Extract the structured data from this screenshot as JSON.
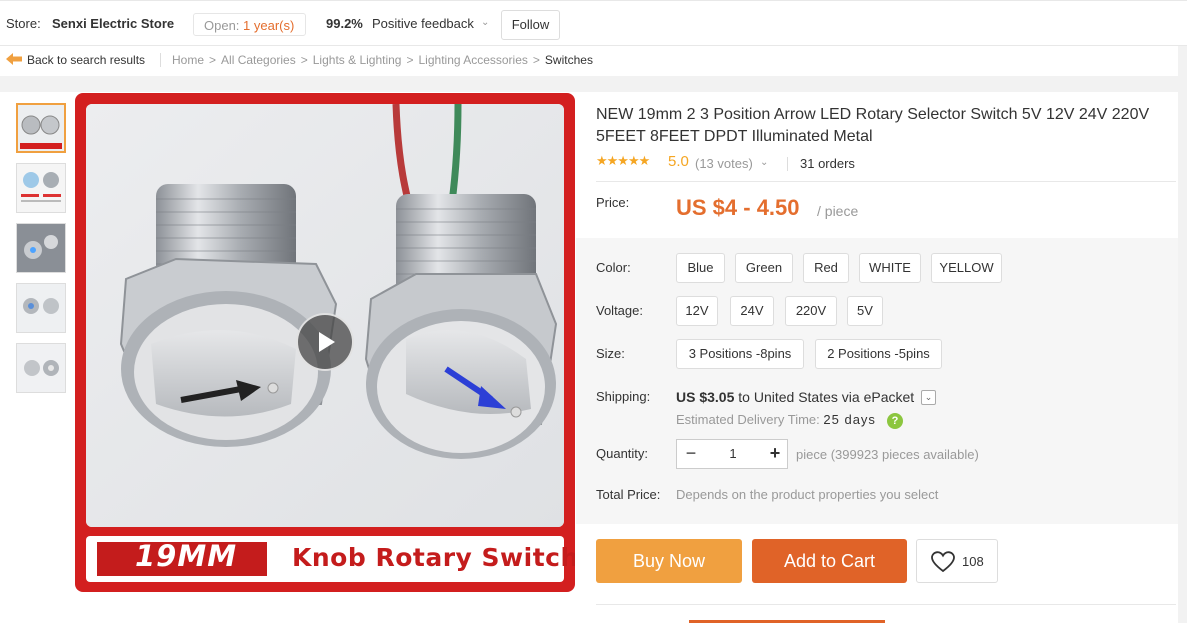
{
  "store": {
    "label": "Store:",
    "name": "Senxi Electric Store",
    "open_prefix": "Open:",
    "open_duration": "1 year(s)",
    "feedback_percent": "99.2%",
    "feedback_label": "Positive feedback",
    "follow_label": "Follow"
  },
  "breadcrumb": {
    "back_label": "Back to search results",
    "items": [
      "Home",
      "All Categories",
      "Lights & Lighting",
      "Lighting Accessories",
      "Switches"
    ]
  },
  "gallery": {
    "banner_left": "19MM",
    "banner_right": "Knob Rotary  Switch",
    "thumbnail_count": 5
  },
  "product": {
    "title": "NEW 19mm 2 3 Position Arrow LED Rotary Selector Switch 5V 12V 24V 220V 5FEET 8FEET DPDT Illuminated Metal",
    "stars": "★★★★★",
    "rating": "5.0",
    "votes": "(13 votes)",
    "orders": "31 orders",
    "price_label": "Price:",
    "price": "US $4 - 4.50",
    "price_unit": "/ piece"
  },
  "options": {
    "color_label": "Color:",
    "colors": [
      "Blue",
      "Green",
      "Red",
      "WHITE",
      "YELLOW"
    ],
    "voltage_label": "Voltage:",
    "voltages": [
      "12V",
      "24V",
      "220V",
      "5V"
    ],
    "size_label": "Size:",
    "sizes": [
      "3 Positions -8pins",
      "2 Positions -5pins"
    ]
  },
  "shipping": {
    "label": "Shipping:",
    "cost": "US $3.05",
    "to_text": " to ",
    "destination": "United States via ePacket",
    "est_label": "Estimated Delivery Time:",
    "est_days": "25 days"
  },
  "quantity": {
    "label": "Quantity:",
    "value": "1",
    "note": "piece (399923 pieces available)"
  },
  "total": {
    "label": "Total Price:",
    "note": "Depends on the product properties you select"
  },
  "actions": {
    "buy_now": "Buy Now",
    "add_to_cart": "Add to Cart",
    "wishlist_count": "108"
  },
  "colors": {
    "accent_orange": "#e46e2e",
    "buy_now_bg": "#f0a040",
    "add_to_cart_bg": "#e06328",
    "star": "#f5a623",
    "banner_red": "#d31f1f"
  }
}
